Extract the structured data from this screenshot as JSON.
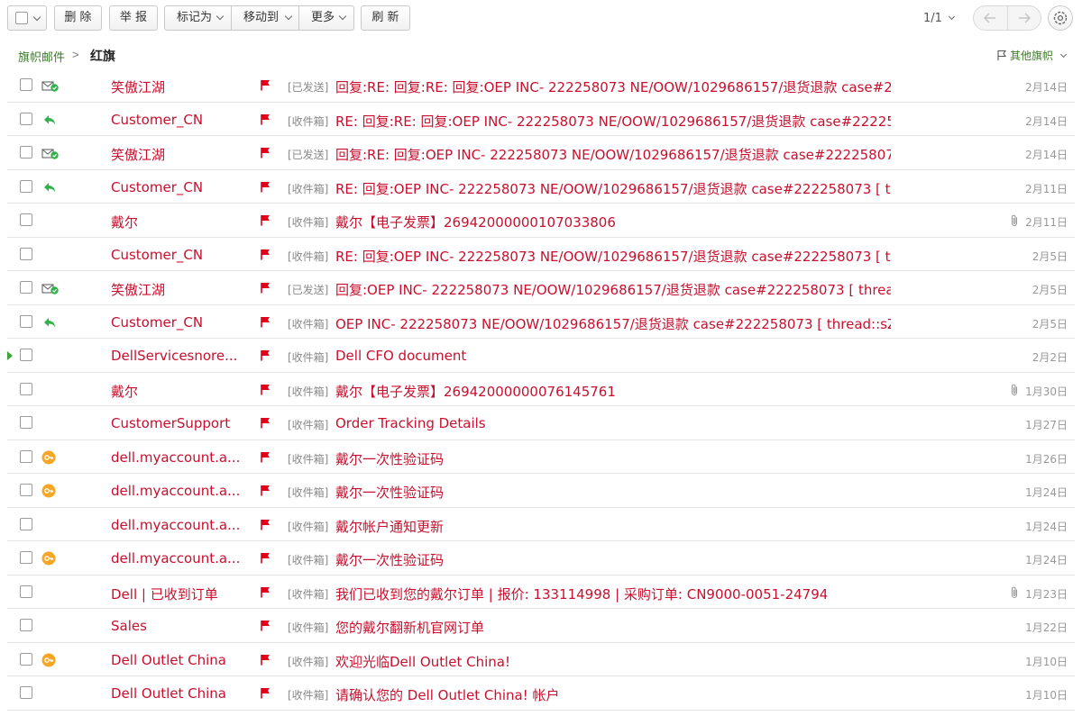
{
  "toolbar": {
    "delete_label": "删 除",
    "report_label": "举 报",
    "mark_as_label": "标记为",
    "move_to_label": "移动到",
    "more_label": "更多",
    "refresh_label": "刷 新",
    "page_info": "1/1"
  },
  "breadcrumb": {
    "parent": "旗帜邮件",
    "separator": ">",
    "current": "红旗",
    "other_flags": "其他旗帜"
  },
  "colors": {
    "accent_red": "#c8102e",
    "link_green": "#3d7a2a",
    "flag_red": "#e0001b",
    "status_green": "#2fb24a",
    "key_orange": "#f5a623"
  },
  "mails": [
    {
      "status_icon": "sent-check-icon",
      "sender": "笑傲江湖",
      "folder": "[已发送]",
      "subject": "回复:RE: 回复:RE: 回复:OEP INC- 222258073 NE/OOW/1029686157/退货退款 case#2.",
      "attachment": false,
      "date": "2月14日"
    },
    {
      "status_icon": "reply-icon",
      "sender": "Customer_CN",
      "folder": "[收件箱]",
      "subject": "RE: 回复:RE: 回复:OEP INC- 222258073 NE/OOW/1029686157/退货退款 case#22225.",
      "attachment": false,
      "date": "2月14日"
    },
    {
      "status_icon": "sent-check-icon",
      "sender": "笑傲江湖",
      "folder": "[已发送]",
      "subject": "回复:RE: 回复:OEP INC- 222258073 NE/OOW/1029686157/退货退款 case#22225807..",
      "attachment": false,
      "date": "2月14日"
    },
    {
      "status_icon": "reply-icon",
      "sender": "Customer_CN",
      "folder": "[收件箱]",
      "subject": "RE: 回复:OEP INC- 222258073 NE/OOW/1029686157/退货退款 case#222258073 [ t...",
      "attachment": false,
      "date": "2月11日"
    },
    {
      "status_icon": "",
      "sender": "戴尔",
      "folder": "[收件箱]",
      "subject": "戴尔【电子发票】26942000000107033806",
      "attachment": true,
      "date": "2月11日"
    },
    {
      "status_icon": "",
      "sender": "Customer_CN",
      "folder": "[收件箱]",
      "subject": "RE: 回复:OEP INC- 222258073 NE/OOW/1029686157/退货退款 case#222258073 [ t...",
      "attachment": false,
      "date": "2月5日"
    },
    {
      "status_icon": "sent-check-icon",
      "sender": "笑傲江湖",
      "folder": "[已发送]",
      "subject": "回复:OEP INC- 222258073 NE/OOW/1029686157/退货退款 case#222258073 [ threa..",
      "attachment": false,
      "date": "2月5日"
    },
    {
      "status_icon": "reply-icon",
      "sender": "Customer_CN",
      "folder": "[收件箱]",
      "subject": "OEP INC- 222258073 NE/OOW/1029686157/退货退款 case#222258073 [ thread::sZ.",
      "attachment": false,
      "date": "2月5日"
    },
    {
      "status_icon": "",
      "sender": "DellServicesnore...",
      "folder": "[收件箱]",
      "subject": "Dell CFO document",
      "attachment": false,
      "date": "2月2日",
      "pointer": true
    },
    {
      "status_icon": "",
      "sender": "戴尔",
      "folder": "[收件箱]",
      "subject": "戴尔【电子发票】26942000000076145761",
      "attachment": true,
      "date": "1月30日"
    },
    {
      "status_icon": "",
      "sender": "CustomerSupport",
      "folder": "[收件箱]",
      "subject": "Order Tracking Details",
      "attachment": false,
      "date": "1月27日"
    },
    {
      "status_icon": "key-icon",
      "sender": "dell.myaccount.a...",
      "folder": "[收件箱]",
      "subject": "戴尔一次性验证码",
      "attachment": false,
      "date": "1月26日"
    },
    {
      "status_icon": "key-icon",
      "sender": "dell.myaccount.a...",
      "folder": "[收件箱]",
      "subject": "戴尔一次性验证码",
      "attachment": false,
      "date": "1月24日"
    },
    {
      "status_icon": "",
      "sender": "dell.myaccount.a...",
      "folder": "[收件箱]",
      "subject": "戴尔帐户通知更新",
      "attachment": false,
      "date": "1月24日"
    },
    {
      "status_icon": "key-icon",
      "sender": "dell.myaccount.a...",
      "folder": "[收件箱]",
      "subject": "戴尔一次性验证码",
      "attachment": false,
      "date": "1月24日"
    },
    {
      "status_icon": "",
      "sender": "Dell | 已收到订单",
      "folder": "[收件箱]",
      "subject": "我们已收到您的戴尔订单 | 报价: 133114998 | 采购订单: CN9000-0051-24794",
      "attachment": true,
      "date": "1月23日"
    },
    {
      "status_icon": "",
      "sender": "Sales",
      "folder": "[收件箱]",
      "subject": "您的戴尔翻新机官网订单",
      "attachment": false,
      "date": "1月22日"
    },
    {
      "status_icon": "key-icon",
      "sender": "Dell Outlet China",
      "folder": "[收件箱]",
      "subject": "欢迎光临Dell Outlet China!",
      "attachment": false,
      "date": "1月10日"
    },
    {
      "status_icon": "",
      "sender": "Dell Outlet China",
      "folder": "[收件箱]",
      "subject": "请确认您的 Dell Outlet China! 帐户",
      "attachment": false,
      "date": "1月10日"
    }
  ]
}
